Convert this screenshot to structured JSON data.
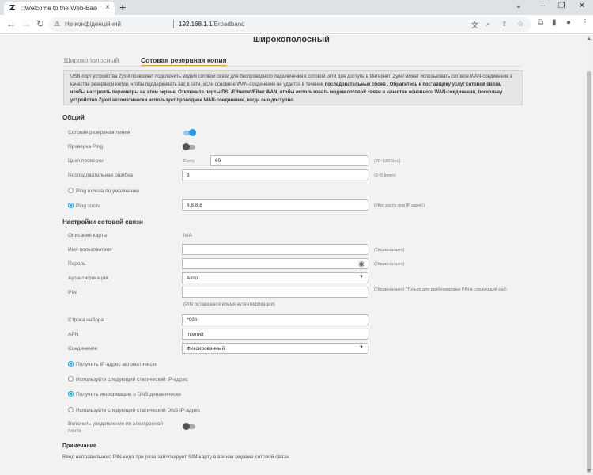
{
  "browser": {
    "tab_favicon": "Z",
    "tab_title": "::Welcome to the Web-Based Co",
    "security_label": "Не конфіденційний",
    "url_host": "192.168.1.1",
    "url_path": "/Broadband",
    "icons": [
      "back-arrow-icon",
      "forward-arrow-icon",
      "reload-icon",
      "warning-icon",
      "translate-icon",
      "zoom-icon",
      "share-icon",
      "star-icon",
      "puzzle-icon",
      "sidebar-icon",
      "profile-icon",
      "menu-icon"
    ]
  },
  "page": {
    "title": "широкополосный",
    "tabs": [
      {
        "label": "Широкополосный",
        "active": false
      },
      {
        "label": "Сотовая резервная копия",
        "active": true
      }
    ],
    "info_text_1": "USB-порт устройства Zyxel позволяет подключить модем сотовой связи для беспроводного подключения к сотовой сети для доступа в Интернет. Zyxel может использовать сотовое WAN-соединение в качестве резервной копии, чтобы поддерживать вас в сети, если основное WAN-соединение не удается в течение ",
    "info_bold_1": "последовательных сбоев . Обратитесь к поставщику услуг сотовой связи, чтобы настроить параметры на этом экране. Отключите порты DSL/Ethernet/Fiber WAN, чтобы использовать модем сотовой связи в качестве основного WAN-соединения, поскольку устройство Zyxel автоматически использует проводное WAN-соединение, когда оно доступно.",
    "general": {
      "heading": "Общий",
      "backup_line_label": "Сотовая резервная линия",
      "backup_line_on": true,
      "ping_check_label": "Проверка Ping",
      "ping_check_on": false,
      "check_cycle_label": "Цикл проверки",
      "check_cycle_prefix": "Every",
      "check_cycle_value": "60",
      "check_cycle_hint": "(20~180 Sec)",
      "consecutive_fail_label": "Последовательная ошибка",
      "consecutive_fail_value": "3",
      "consecutive_fail_hint": "(2~5 times)",
      "ping_gateway_label": "Ping шлюза по умолчанию",
      "ping_host_label": "Ping хоста",
      "ping_host_value": "8.8.8.8",
      "ping_host_hint": "(Имя хоста или IP адрес)"
    },
    "cellular": {
      "heading": "Настройки сотовой связи",
      "card_desc_label": "Описание карты",
      "card_desc_value": "N/A",
      "username_label": "Имя пользователя",
      "username_hint": "(Опционально)",
      "password_label": "Пароль",
      "password_hint": "(Опционально)",
      "auth_label": "Аутентификация",
      "auth_value": "Авто",
      "pin_label": "PIN",
      "pin_hint": "(Опционально) (Только для разблокировки PIN в следующий раз)",
      "pin_remaining": "(PIN оставшееся время аутентификации)",
      "dial_label": "Строка набора",
      "dial_value": "*99#",
      "apn_label": "APN",
      "apn_value": "internet",
      "connection_label": "Соединение",
      "connection_value": "Фиксированный",
      "ip_auto_label": "Получить IP-адрес автоматически",
      "ip_static_label": "Используйте следующий статический IP-адрес",
      "dns_dynamic_label": "Получить информацию о DNS динамически",
      "dns_static_label": "Используйте следующий статический DNS IP-адрес",
      "email_notify_label": "Включить уведомление по электронной почте",
      "email_notify_on": false
    },
    "note": {
      "title": "Примечание",
      "text": "Ввод неправильного PIN-кода три раза заблокирует SIM-карту в вашем модеме сотовой связи."
    }
  }
}
